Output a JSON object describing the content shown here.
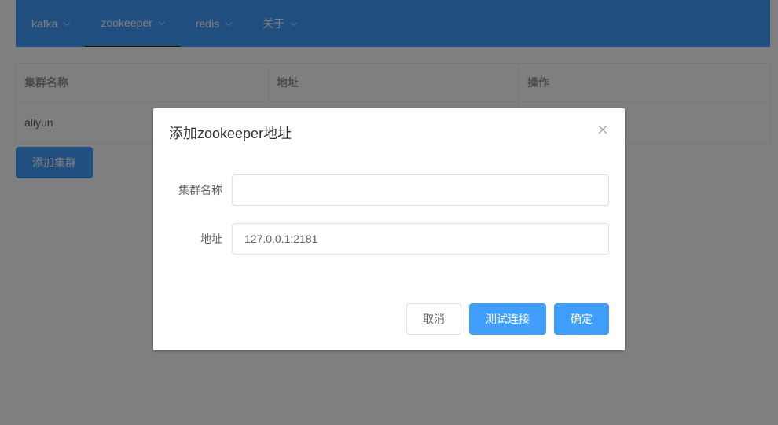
{
  "nav": {
    "items": [
      {
        "label": "kafka"
      },
      {
        "label": "zookeeper"
      },
      {
        "label": "redis"
      },
      {
        "label": "关于"
      }
    ]
  },
  "table": {
    "headers": [
      "集群名称",
      "地址",
      "操作"
    ],
    "rows": [
      [
        "aliyun",
        "",
        ""
      ]
    ]
  },
  "page": {
    "add_cluster_label": "添加集群"
  },
  "dialog": {
    "title": "添加zookeeper地址",
    "fields": [
      {
        "label": "集群名称",
        "value": ""
      },
      {
        "label": "地址",
        "value": "127.0.0.1:2181"
      }
    ],
    "cancel_label": "取消",
    "test_label": "测试连接",
    "ok_label": "确定"
  },
  "colors": {
    "primary": "#409eff",
    "overlay": "rgba(0,0,0,0.5)"
  }
}
